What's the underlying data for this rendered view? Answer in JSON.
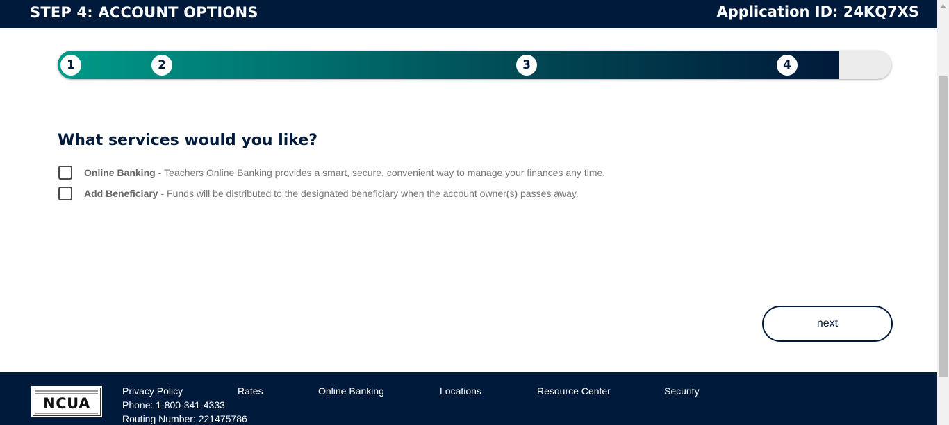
{
  "header": {
    "step_title": "STEP 4: ACCOUNT OPTIONS",
    "application_id": "Application ID: 24KQ7XS"
  },
  "progress": {
    "fill_fraction": 0.9375,
    "steps": [
      "1",
      "2",
      "3",
      "4"
    ]
  },
  "services": {
    "question": "What services would you like?",
    "options": [
      {
        "name": "Online Banking",
        "description": "Teachers Online Banking provides a smart, secure, convenient way to manage your finances any time.",
        "checked": false
      },
      {
        "name": "Add Beneficiary",
        "description": "Funds will be distributed to the designated beneficiary when the account owner(s) passes away.",
        "checked": false
      }
    ],
    "separator": " - "
  },
  "actions": {
    "next_label": "next"
  },
  "footer": {
    "logo_text": "NCUA",
    "links": [
      "Privacy Policy",
      "Rates",
      "Online Banking",
      "Locations",
      "Resource Center",
      "Security"
    ],
    "phone": "Phone: 1-800-341-4333",
    "routing": "Routing Number: 221475786"
  },
  "colors": {
    "navy": "#001a3b",
    "teal": "#009a87"
  }
}
